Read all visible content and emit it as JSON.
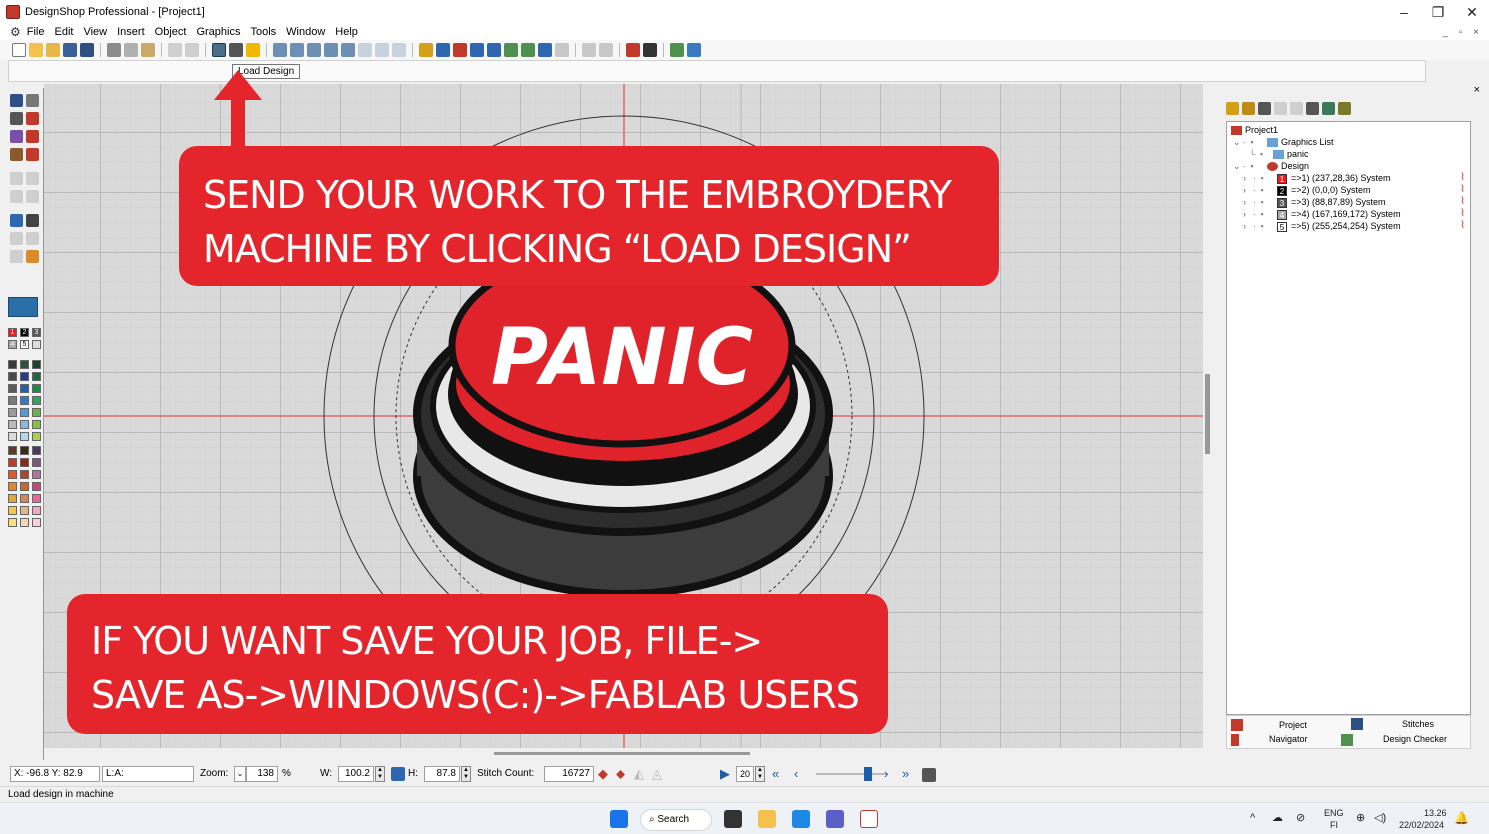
{
  "window": {
    "title": "DesignShop Professional - [Project1]",
    "minimize": "–",
    "restore": "❐",
    "close": "✕",
    "mdi_controls": "_ ▫ ×"
  },
  "menu": [
    "File",
    "Edit",
    "View",
    "Insert",
    "Object",
    "Graphics",
    "Tools",
    "Window",
    "Help"
  ],
  "toolbar": {
    "tooltip": "Load Design"
  },
  "canvas": {
    "design_text": "PANIC"
  },
  "panel": {
    "close": "×",
    "tree": {
      "project": "Project1",
      "graphics_list": "Graphics List",
      "graphic_item": "panic",
      "design": "Design",
      "colors": [
        {
          "num": "1",
          "label": "=>1) (237,28,36) System",
          "hex": "#ed1c24"
        },
        {
          "num": "2",
          "label": "=>2) (0,0,0) System",
          "hex": "#000000"
        },
        {
          "num": "3",
          "label": "=>3) (88,87,89) System",
          "hex": "#585759"
        },
        {
          "num": "4",
          "label": "=>4) (167,169,172) System",
          "hex": "#a7a9ac"
        },
        {
          "num": "5",
          "label": "=>5) (255,254,254) System",
          "hex": "#fffefe"
        }
      ]
    },
    "tabs": {
      "project": "Project",
      "stitches": "Stitches",
      "navigator": "Navigator",
      "design_checker": "Design Checker"
    }
  },
  "palette": {
    "mini": [
      "1",
      "2",
      "3",
      "4",
      "5"
    ]
  },
  "info": {
    "coords": "X: -96.8  Y: 82.9",
    "layer": "L:A:",
    "zoom_label": "Zoom:",
    "zoom_value": "138",
    "zoom_unit": "%",
    "w_label": "W:",
    "w_value": "100.2",
    "h_label": "H:",
    "h_value": "87.8",
    "stitch_label": "Stitch Count:",
    "stitch_value": "16727",
    "speed": "20"
  },
  "status": "Load design in machine",
  "taskbar": {
    "search": "Search",
    "lang": "ENG",
    "lang_sub": "FI",
    "time": "13.26",
    "date": "22/02/2024"
  },
  "callouts": {
    "top": [
      "SEND YOUR WORK TO THE EMBROYDERY",
      "MACHINE BY CLICKING “LOAD DESIGN”"
    ],
    "bottom": [
      "IF YOU WANT SAVE YOUR JOB, FILE->",
      "SAVE AS->WINDOWS(C:)->FABLAB USERS"
    ]
  },
  "colors": {
    "callout_red": "#e4262c",
    "panic_red": "#e0222a",
    "canvas_bg": "#d9d9d9",
    "accent_blue": "#1c5fa8"
  }
}
